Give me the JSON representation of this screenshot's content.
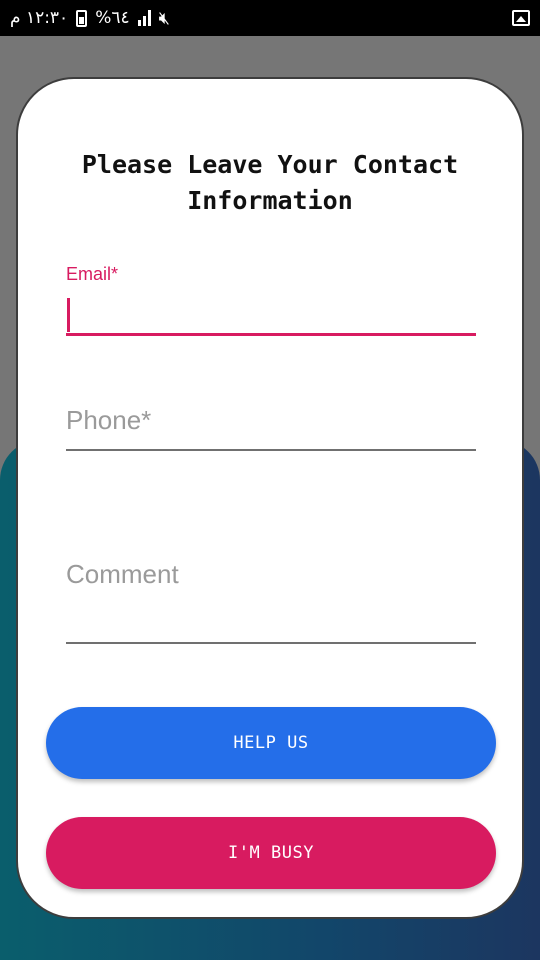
{
  "status_bar": {
    "time": "١٢:٣٠ م",
    "battery": "%٦٤",
    "icons": [
      "battery-icon",
      "signal-icon",
      "mute-icon",
      "image-icon"
    ]
  },
  "dialog": {
    "title": "Please Leave Your Contact Information",
    "email": {
      "label": "Email*",
      "value": ""
    },
    "phone": {
      "placeholder": "Phone*",
      "value": ""
    },
    "comment": {
      "placeholder": "Comment",
      "value": ""
    },
    "help_button": "HELP US",
    "busy_button": "I'M BUSY"
  },
  "colors": {
    "accent": "#d81b60",
    "primary_button": "#246ee9",
    "secondary_button": "#d81b60"
  }
}
